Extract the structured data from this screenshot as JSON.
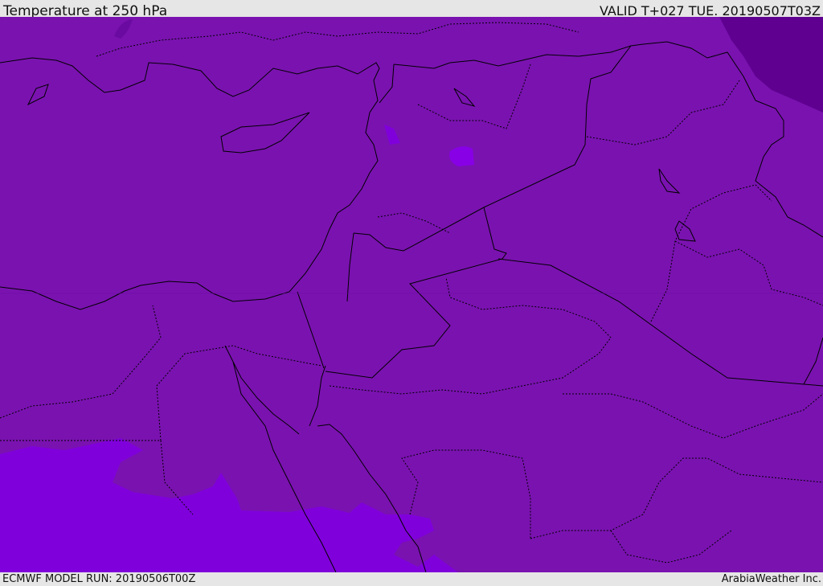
{
  "header": {
    "title": "Temperature at 250 hPa",
    "valid": "VALID T+027 TUE. 20190507T03Z"
  },
  "footer": {
    "model_run": "ECMWF MODEL RUN: 20190506T00Z",
    "brand": "ArabiaWeather Inc."
  },
  "colors": {
    "base": "#7a12b0",
    "cold_ne": "#5f0090",
    "warm_sw": "#8000dc",
    "border": "#000000"
  }
}
